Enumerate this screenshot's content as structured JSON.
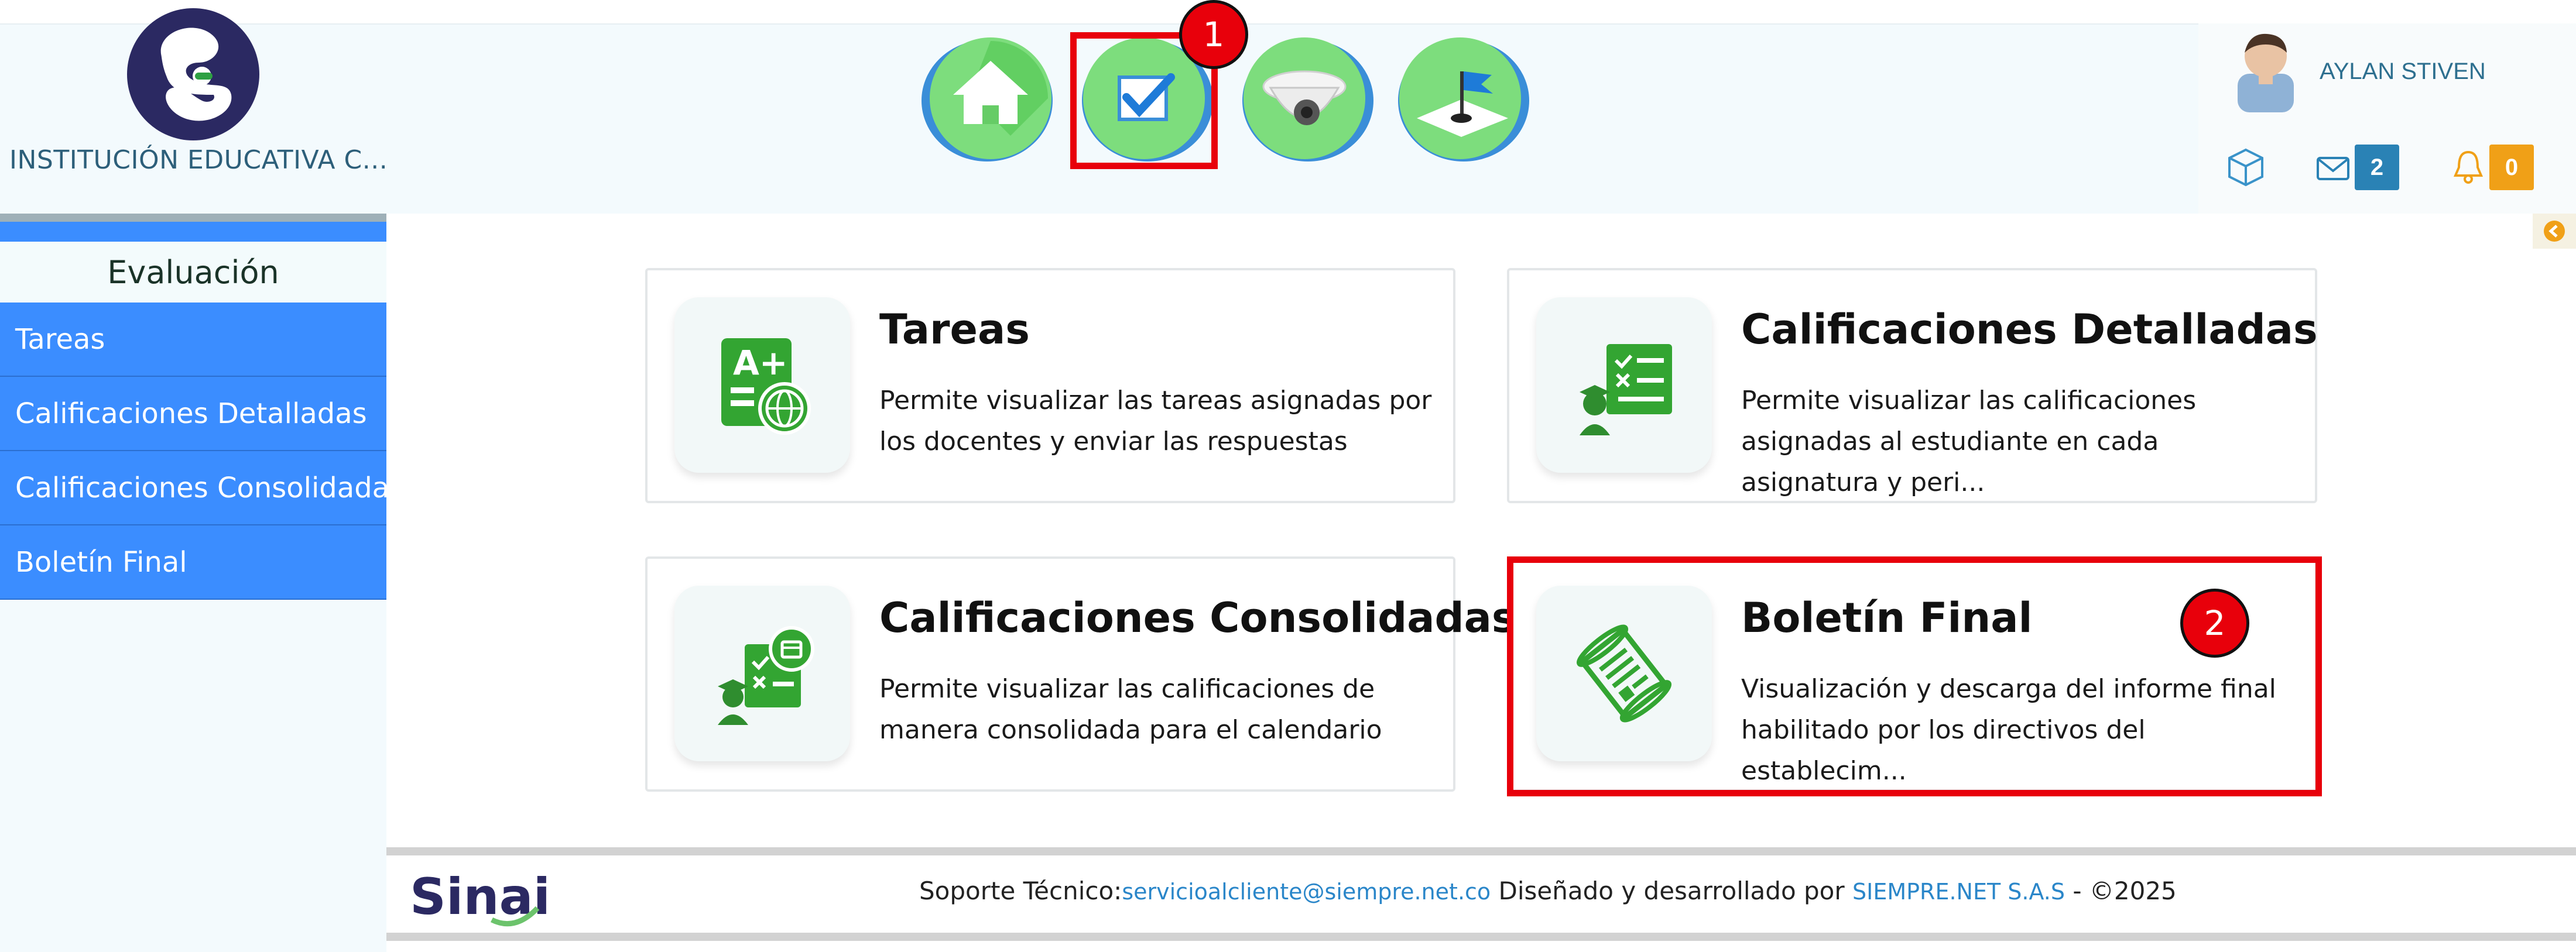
{
  "header": {
    "institution_name": "INSTITUCIÓN EDUCATIVA C...",
    "nav": [
      {
        "name": "home-icon"
      },
      {
        "name": "checkbox-icon"
      },
      {
        "name": "security-camera-icon"
      },
      {
        "name": "graduation-icon"
      }
    ],
    "user": {
      "name": "AYLAN STIVEN",
      "messages_count": "2",
      "notifications_count": "0"
    }
  },
  "annotations": {
    "step1": "1",
    "step2": "2"
  },
  "sidebar": {
    "title": "Evaluación",
    "items": [
      {
        "label": "Tareas"
      },
      {
        "label": "Calificaciones Detalladas"
      },
      {
        "label": "Calificaciones Consolidadas"
      },
      {
        "label": "Boletín Final"
      }
    ]
  },
  "cards": [
    {
      "title": "Tareas",
      "description": "Permite visualizar las tareas asignadas por los docentes y enviar las respuestas",
      "icon": "tasks-icon"
    },
    {
      "title": "Calificaciones Detalladas",
      "description": "Permite visualizar las calificaciones asignadas al estudiante en cada asignatura y peri...",
      "icon": "detailed-grades-icon"
    },
    {
      "title": "Calificaciones Consolidadas",
      "description": "Permite visualizar las calificaciones de manera consolidada para el calendario",
      "icon": "consolidated-grades-icon"
    },
    {
      "title": "Boletín Final",
      "description": "Visualización y descarga del informe final habilitado por los directivos del establecim...",
      "icon": "diploma-icon"
    }
  ],
  "footer": {
    "logo_text": "Sinai",
    "support_label": "Soporte Técnico:",
    "support_email": "servicioalcliente@siempre.net.co",
    "designed_by": "Diseñado y desarrollado por",
    "company": "SIEMPRE.NET S.A.S",
    "separator": "-",
    "copyright": "©2025"
  },
  "colors": {
    "accent_blue": "#3b8dff",
    "icon_green": "#33a532",
    "highlight_red": "#e8000b",
    "message_badge": "#2a82b5",
    "notification_badge": "#f0a017"
  }
}
